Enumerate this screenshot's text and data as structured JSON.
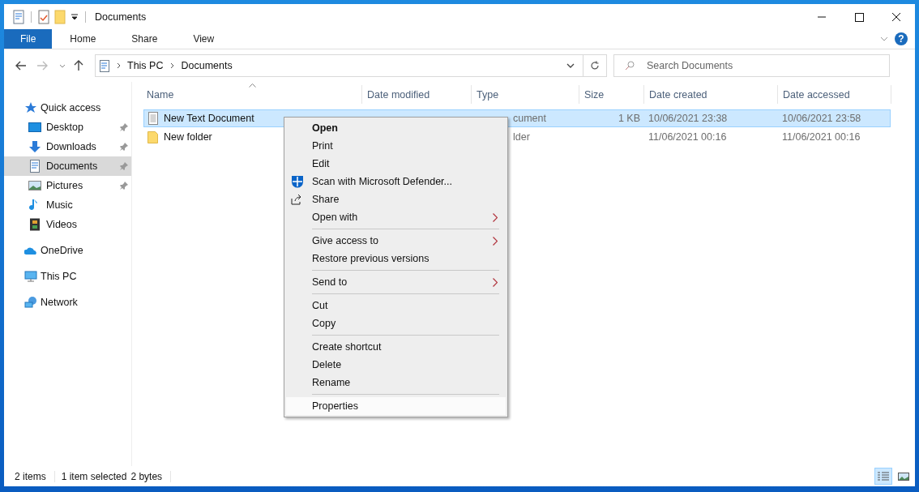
{
  "window": {
    "title": "Documents"
  },
  "ribbon": {
    "tabs": [
      {
        "label": "File",
        "kind": "file"
      },
      {
        "label": "Home",
        "kind": "tab"
      },
      {
        "label": "Share",
        "kind": "tab"
      },
      {
        "label": "View",
        "kind": "tab"
      }
    ],
    "help": "?"
  },
  "address": {
    "crumbs": [
      "This PC",
      "Documents"
    ],
    "search_placeholder": "Search Documents"
  },
  "navigation": [
    {
      "label": "Quick access",
      "kind": "star",
      "selected": false,
      "children": [
        {
          "label": "Desktop",
          "kind": "desktop",
          "selected": false,
          "pinned": true
        },
        {
          "label": "Downloads",
          "kind": "download",
          "selected": false,
          "pinned": true
        },
        {
          "label": "Documents",
          "kind": "document",
          "selected": true,
          "pinned": true
        },
        {
          "label": "Pictures",
          "kind": "pictures",
          "selected": false,
          "pinned": true
        },
        {
          "label": "Music",
          "kind": "music",
          "selected": false,
          "pinned": false
        },
        {
          "label": "Videos",
          "kind": "videos",
          "selected": false,
          "pinned": false
        }
      ]
    },
    {
      "label": "OneDrive",
      "kind": "cloud",
      "selected": false
    },
    {
      "label": "This PC",
      "kind": "pc",
      "selected": false
    },
    {
      "label": "Network",
      "kind": "network",
      "selected": false
    }
  ],
  "table": {
    "columns": [
      {
        "label": "Name",
        "sorted": true
      },
      {
        "label": "Date modified",
        "sorted": false
      },
      {
        "label": "Type",
        "sorted": false
      },
      {
        "label": "Size",
        "sorted": false
      },
      {
        "label": "Date created",
        "sorted": false
      },
      {
        "label": "Date accessed",
        "sorted": false
      }
    ],
    "rows": [
      {
        "kind": "text",
        "selected": true,
        "name": "New Text Document",
        "type": "cument",
        "size": "1 KB",
        "created": "10/06/2021 23:38",
        "accessed": "10/06/2021 23:58"
      },
      {
        "kind": "folder",
        "selected": false,
        "name": "New folder",
        "type": "lder",
        "created": "11/06/2021 00:16",
        "accessed": "11/06/2021 00:16"
      }
    ]
  },
  "context_menu": [
    {
      "kind": "item",
      "label": "Open",
      "default": true,
      "submenu": false,
      "selected": false
    },
    {
      "kind": "item",
      "label": "Print",
      "default": false,
      "submenu": false,
      "selected": false
    },
    {
      "kind": "item",
      "label": "Edit",
      "default": false,
      "submenu": false,
      "selected": false
    },
    {
      "kind": "shield_item",
      "label": "Scan with Microsoft Defender...",
      "default": false,
      "submenu": false,
      "selected": false
    },
    {
      "kind": "share_item",
      "label": "Share",
      "default": false,
      "submenu": false,
      "selected": false
    },
    {
      "kind": "item",
      "label": "Open with",
      "default": false,
      "submenu": true,
      "selected": false
    },
    {
      "kind": "separator"
    },
    {
      "kind": "item",
      "label": "Give access to",
      "default": false,
      "submenu": true,
      "selected": false
    },
    {
      "kind": "item",
      "label": "Restore previous versions",
      "default": false,
      "submenu": false,
      "selected": false
    },
    {
      "kind": "separator"
    },
    {
      "kind": "item",
      "label": "Send to",
      "default": false,
      "submenu": true,
      "selected": false
    },
    {
      "kind": "separator"
    },
    {
      "kind": "item",
      "label": "Cut",
      "default": false,
      "submenu": false,
      "selected": false
    },
    {
      "kind": "item",
      "label": "Copy",
      "default": false,
      "submenu": false,
      "selected": false
    },
    {
      "kind": "separator"
    },
    {
      "kind": "item",
      "label": "Create shortcut",
      "default": false,
      "submenu": false,
      "selected": false
    },
    {
      "kind": "item",
      "label": "Delete",
      "default": false,
      "submenu": false,
      "selected": false
    },
    {
      "kind": "item",
      "label": "Rename",
      "default": false,
      "submenu": false,
      "selected": false
    },
    {
      "kind": "separator"
    },
    {
      "kind": "item",
      "label": "Properties",
      "default": false,
      "submenu": false,
      "selected": true
    }
  ],
  "status_bar": {
    "items": [
      "2 items",
      "1 item selected",
      "2 bytes"
    ],
    "views": [
      {
        "kind": "details",
        "selected": true
      },
      {
        "kind": "large_icons",
        "selected": false
      }
    ]
  }
}
